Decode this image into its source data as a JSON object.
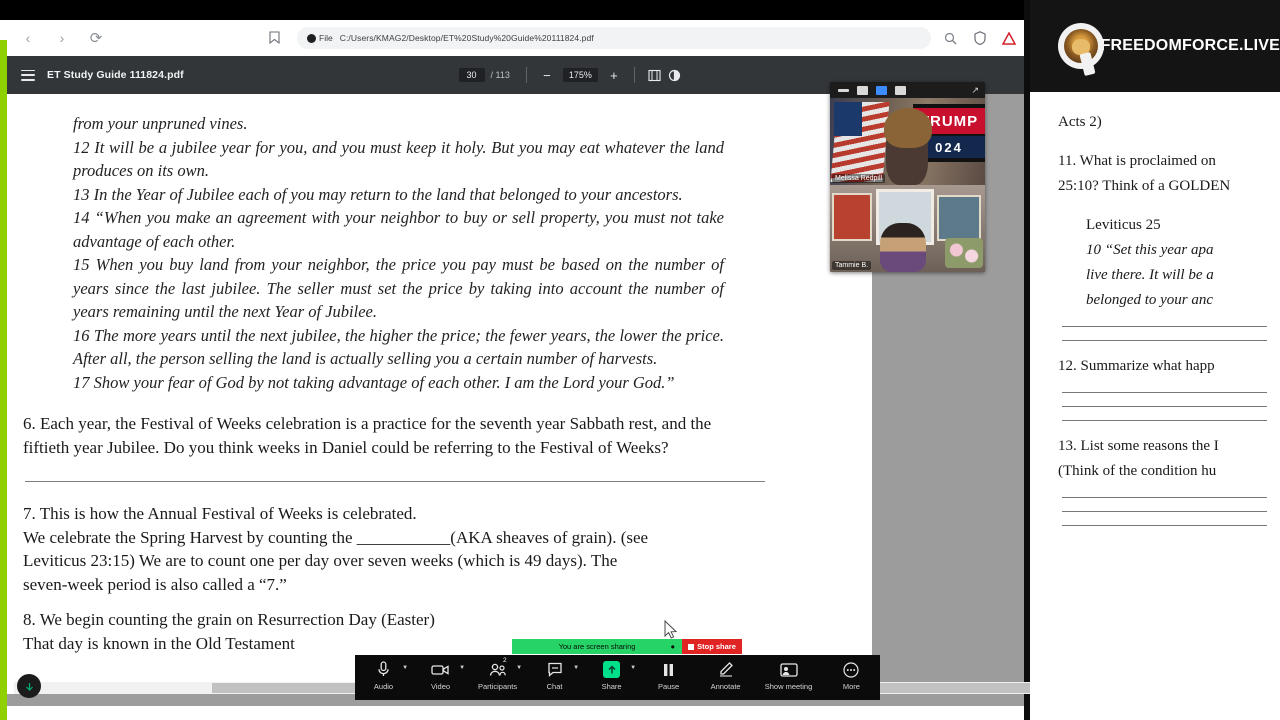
{
  "browser": {
    "back_icon": "back-arrow-icon",
    "forward_icon": "forward-arrow-icon",
    "reload_icon": "reload-icon",
    "bookmark_icon": "bookmark-icon",
    "file_label": "File",
    "url": "C:/Users/KMAG2/Desktop/ET%20Study%20Guide%20111824.pdf",
    "right_icons": [
      "zoom-icon",
      "shield-icon",
      "adobe-warning-icon"
    ]
  },
  "pdf_toolbar": {
    "menu_icon": "hamburger-menu-icon",
    "title": "ET Study Guide 111824.pdf",
    "current_page": "30",
    "page_separator": "/",
    "total_pages": "113",
    "zoom_out": "−",
    "zoom_level": "175%",
    "zoom_in": "+",
    "fit_icon": "fit-to-page-icon",
    "rotate_icon": "rotate-icon"
  },
  "document": {
    "verses_top": [
      "from your unpruned vines.",
      "12 It will be a jubilee year for you, and you must keep it holy. But you may eat whatever the land produces on its own.",
      "13 In the Year of Jubilee each of you may return to the land that belonged to your ancestors.",
      "14 “When you make an agreement with your neighbor to buy or sell property, you must not take advantage of each other.",
      "15 When you buy land from your neighbor, the price you pay must be based on the number of years since the last jubilee. The seller must set the price by taking into account the number of years remaining until the next Year of Jubilee.",
      "16 The more years until the next jubilee, the higher the price; the fewer years, the lower the price. After all, the person selling the land is actually selling you a certain number of harvests.",
      "17 Show your fear of God by not taking advantage of each other. I am the Lord your God.”"
    ],
    "question6": "6. Each year, the Festival of Weeks celebration is a practice for the seventh year Sabbath rest, and the fiftieth year Jubilee.  Do you think weeks in Daniel could be referring to the Festival of Weeks?",
    "question7_lines": [
      "7. This is how the Annual Festival of Weeks is celebrated.",
      "We celebrate the Spring Harvest by counting the ___________(AKA sheaves of grain).  (see",
      "Leviticus 23:15)  We are to count one per day over seven weeks (which is 49 days).  The",
      "seven-week period is also called a “7.”"
    ],
    "question8_lines": [
      "8. We begin counting the grain on Resurrection Day (Easter)",
      "That day is known in the Old Testament"
    ]
  },
  "right_panel": {
    "logo_text": "FREEDOMFORCE.LIVE",
    "logo_icon": "q-lion-logo-icon",
    "lines": [
      {
        "text": "Acts 2)",
        "italic": false,
        "indent": false
      },
      {
        "text": "",
        "italic": false,
        "indent": false
      },
      {
        "text": "11. What is proclaimed on",
        "italic": false,
        "indent": false
      },
      {
        "text": "25:10? Think of a GOLDEN",
        "italic": false,
        "indent": false
      },
      {
        "text": "",
        "italic": false,
        "indent": false
      },
      {
        "text": "Leviticus 25",
        "italic": false,
        "indent": true
      },
      {
        "text": "10 “Set this year apa",
        "italic": true,
        "indent": true
      },
      {
        "text": "live there. It will be a",
        "italic": true,
        "indent": true
      },
      {
        "text": "belonged to your anc",
        "italic": true,
        "indent": true
      }
    ],
    "question12": "12. Summarize what happ",
    "question13_lines": [
      "13. List some reasons the I",
      "(Think of the condition hu"
    ]
  },
  "video_panel": {
    "controls": [
      "minimize-icon",
      "single-view-icon",
      "strip-view-icon",
      "grid-view-icon",
      "expand-icon"
    ],
    "tiles": [
      {
        "name": "Melissa Redpill",
        "sign_top": "TRUMP",
        "sign_bottom": "024"
      },
      {
        "name": "Tammie B."
      }
    ]
  },
  "share_bar": {
    "status_text": "You are screen sharing",
    "share_icon": "screen-share-icon",
    "pause_icon": "annotate-pen-icon",
    "stop_label": "Stop share"
  },
  "zoom_toolbar": {
    "items": [
      {
        "label": "Audio",
        "icon": "microphone-icon",
        "caret": true,
        "badge": ""
      },
      {
        "label": "Video",
        "icon": "camera-icon",
        "caret": true,
        "badge": ""
      },
      {
        "label": "Participants",
        "icon": "participants-icon",
        "caret": true,
        "badge": "2"
      },
      {
        "label": "Chat",
        "icon": "chat-bubble-icon",
        "caret": true,
        "badge": ""
      },
      {
        "label": "Share",
        "icon": "share-screen-icon",
        "caret": true,
        "badge": ""
      },
      {
        "label": "Pause",
        "icon": "pause-icon",
        "caret": false,
        "badge": ""
      },
      {
        "label": "Annotate",
        "icon": "pencil-icon",
        "caret": false,
        "badge": ""
      },
      {
        "label": "Show meeting",
        "icon": "show-meeting-icon",
        "caret": false,
        "badge": ""
      },
      {
        "label": "More",
        "icon": "more-dots-icon",
        "caret": false,
        "badge": ""
      }
    ]
  },
  "colors": {
    "accent_green": "#8ed000",
    "share_green": "#25d366",
    "stop_red": "#e02424",
    "toolbar_dark": "#323639"
  }
}
